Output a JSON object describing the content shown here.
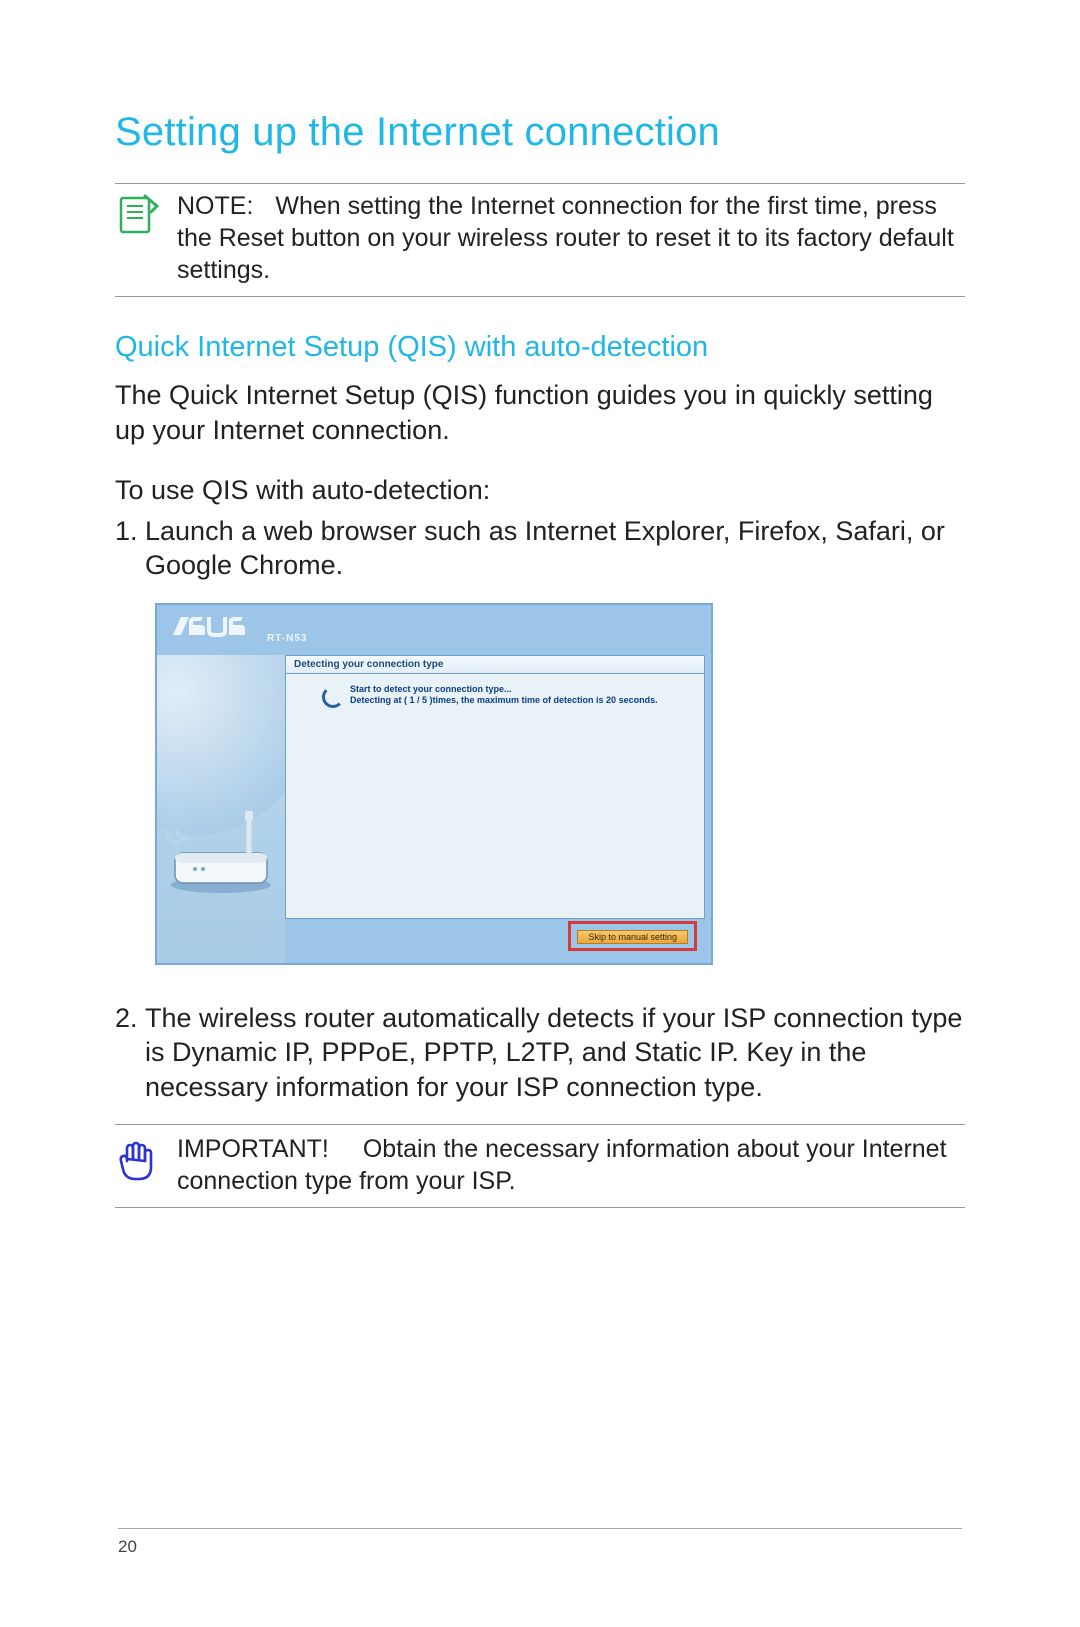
{
  "title": "Setting up the Internet connection",
  "note": {
    "label": "NOTE:",
    "text": "When setting the Internet connection for the first time, press the Reset button on your wireless router to reset it to its factory default settings."
  },
  "subsection": "Quick Internet Setup (QIS) with auto-detection",
  "intro": "The Quick Internet Setup (QIS) function guides you in quickly setting up your Internet connection.",
  "lead": "To use QIS with auto-detection:",
  "steps": [
    {
      "num": "1.",
      "text": "Launch a web browser such as Internet Explorer, Firefox, Safari, or Google Chrome."
    },
    {
      "num": "2.",
      "text": "The wireless router automatically detects if your ISP connection type is Dynamic IP, PPPoE, PPTP, L2TP, and Static IP. Key in the necessary information for your ISP connection type."
    }
  ],
  "screenshot": {
    "model": "RT-N53",
    "panel_title": "Detecting your connection type",
    "detect_line1": "Start to detect your connection type...",
    "detect_line2": "Detecting at ( 1 / 5 )times, the maximum time of detection is 20 seconds.",
    "skip_button": "Skip to manual setting"
  },
  "important": {
    "label": "IMPORTANT!",
    "text": "Obtain the necessary information about your Internet connection type from your ISP."
  },
  "page_number": "20"
}
